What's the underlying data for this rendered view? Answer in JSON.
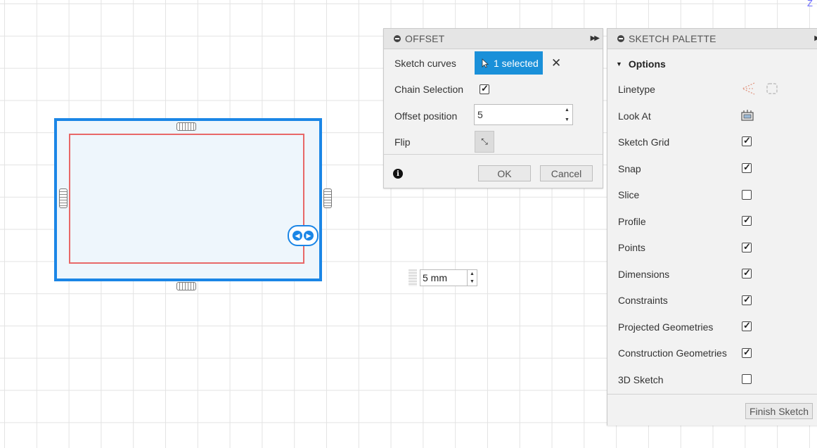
{
  "canvas": {
    "corner_axis_label": "Z",
    "dimension_input": {
      "value": "5 mm"
    }
  },
  "offset_dialog": {
    "title": "OFFSET",
    "sketch_curves_label": "Sketch curves",
    "selection_button_label": "1 selected",
    "chain_selection_label": "Chain Selection",
    "chain_selection_checked": true,
    "offset_position_label": "Offset position",
    "offset_position_value": "5",
    "flip_label": "Flip",
    "ok_label": "OK",
    "cancel_label": "Cancel"
  },
  "sketch_palette": {
    "title": "SKETCH PALETTE",
    "options_label": "Options",
    "linetype_label": "Linetype",
    "look_at_label": "Look At",
    "options": [
      {
        "label": "Sketch Grid",
        "checked": true
      },
      {
        "label": "Snap",
        "checked": true
      },
      {
        "label": "Slice",
        "checked": false
      },
      {
        "label": "Profile",
        "checked": true
      },
      {
        "label": "Points",
        "checked": true
      },
      {
        "label": "Dimensions",
        "checked": true
      },
      {
        "label": "Constraints",
        "checked": true
      },
      {
        "label": "Projected Geometries",
        "checked": true
      },
      {
        "label": "Construction Geometries",
        "checked": true
      },
      {
        "label": "3D Sketch",
        "checked": false
      }
    ],
    "finish_label": "Finish Sketch"
  },
  "colors": {
    "selection_blue": "#1a90d9",
    "sketch_outline": "#1b86e6",
    "offset_curve": "#e86868"
  }
}
